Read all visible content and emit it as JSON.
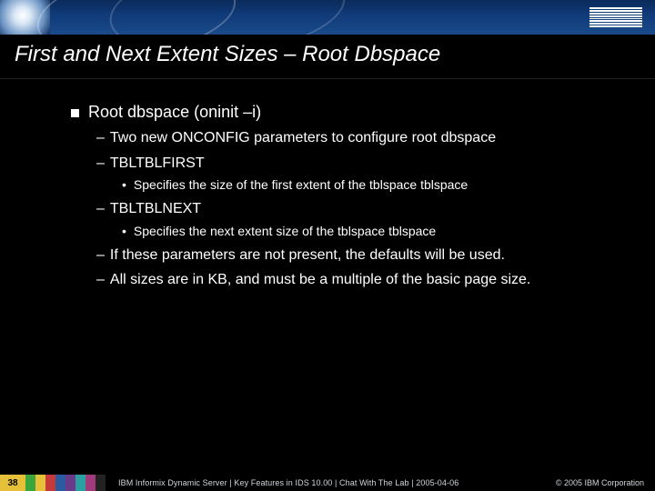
{
  "header": {
    "logo_text": "IBM"
  },
  "title": "First and Next Extent Sizes – Root Dbspace",
  "bullets": {
    "l1": "Root dbspace (oninit –i)",
    "l2a": "Two new ONCONFIG parameters to configure root dbspace",
    "l2b": "TBLTBLFIRST",
    "l3b": "Specifies the size of the first extent of the tblspace tblspace",
    "l2c": "TBLTBLNEXT",
    "l3c": "Specifies the next extent size of the tblspace tblspace",
    "l2d": "If these parameters are not present, the defaults will be used.",
    "l2e": "All sizes are in KB, and must be a multiple of the basic page size."
  },
  "footer": {
    "slidenum": "38",
    "line": "IBM Informix Dynamic Server | Key Features in IDS 10.00 | Chat With The Lab | 2005-04-06",
    "copyright": "© 2005 IBM Corporation"
  }
}
